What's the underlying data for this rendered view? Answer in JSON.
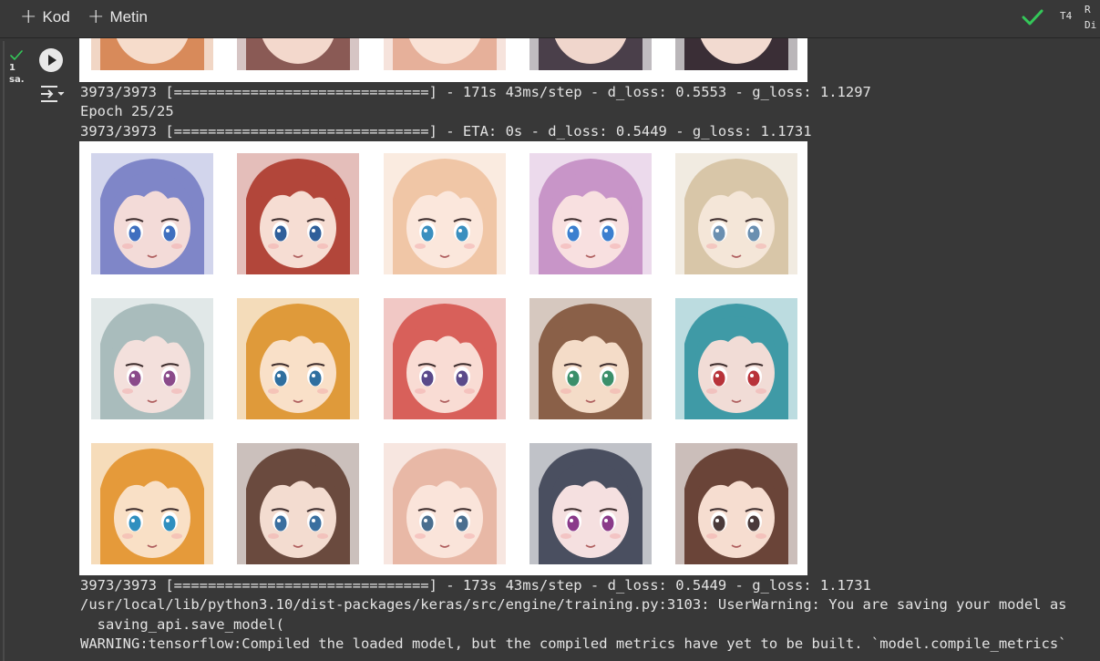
{
  "toolbar": {
    "add_code_label": "Kod",
    "add_text_label": "Metin",
    "runtime_label": "T4",
    "resource_line1": "R",
    "resource_line2": "Di"
  },
  "cell": {
    "exec_count_line1": "1",
    "exec_count_line2": "sa."
  },
  "output": {
    "lines": [
      "3973/3973 [==============================] - 171s 43ms/step - d_loss: 0.5553 - g_loss: 1.1297",
      "Epoch 25/25",
      "3973/3973 [==============================] - ETA: 0s - d_loss: 0.5449 - g_loss: 1.1731",
      "3973/3973 [==============================] - 173s 43ms/step - d_loss: 0.5449 - g_loss: 1.1731",
      "/usr/local/lib/python3.10/dist-packages/keras/src/engine/training.py:3103: UserWarning: You are saving your model as",
      "  saving_api.save_model(",
      "WARNING:tensorflow:Compiled the loaded model, but the compiled metrics have yet to be built. `model.compile_metrics`"
    ]
  },
  "faces_top": [
    {
      "hair": "#d88a5a",
      "skin": "#f6dccb"
    },
    {
      "hair": "#8a5a55",
      "skin": "#f3d8cc"
    },
    {
      "hair": "#e6b09a",
      "skin": "#f9e2d6"
    },
    {
      "hair": "#4a3f4a",
      "skin": "#f0d6cc"
    },
    {
      "hair": "#3a2e36",
      "skin": "#f2dad0"
    }
  ],
  "faces_main": [
    {
      "hair": "#7f86c8",
      "skin": "#f3dbd8",
      "eye": "#3f6fbf"
    },
    {
      "hair": "#b2463a",
      "skin": "#f6ddd3",
      "eye": "#2f5f9a"
    },
    {
      "hair": "#f0c6a6",
      "skin": "#fbe7dc",
      "eye": "#3a8fbf"
    },
    {
      "hair": "#c895c8",
      "skin": "#f8e0e0",
      "eye": "#3b7fcf"
    },
    {
      "hair": "#d8c6a8",
      "skin": "#f4e6d8",
      "eye": "#6a8fb0"
    },
    {
      "hair": "#a9bcbc",
      "skin": "#f3e0dc",
      "eye": "#8a4a8a"
    },
    {
      "hair": "#df9a3a",
      "skin": "#f9e0c8",
      "eye": "#2f6f9f"
    },
    {
      "hair": "#d8605a",
      "skin": "#f9dcd4",
      "eye": "#5a4a8a"
    },
    {
      "hair": "#8a6048",
      "skin": "#f4dcc8",
      "eye": "#3a8f6a"
    },
    {
      "hair": "#3f9aa6",
      "skin": "#f1dcd6",
      "eye": "#b8333a"
    },
    {
      "hair": "#e59a3a",
      "skin": "#f9e0c6",
      "eye": "#2f8fbf"
    },
    {
      "hair": "#6a4a3e",
      "skin": "#f3dcd0",
      "eye": "#3a6f9f"
    },
    {
      "hair": "#e8b8a6",
      "skin": "#fae4da",
      "eye": "#4a6f8f"
    },
    {
      "hair": "#4a4f60",
      "skin": "#f5e0e0",
      "eye": "#8a3a8a"
    },
    {
      "hair": "#6a4438",
      "skin": "#f6ddd0",
      "eye": "#4a3a3a"
    }
  ],
  "colors": {
    "background": "#383838",
    "text": "#e3e3e3",
    "success_green": "#34c759"
  }
}
